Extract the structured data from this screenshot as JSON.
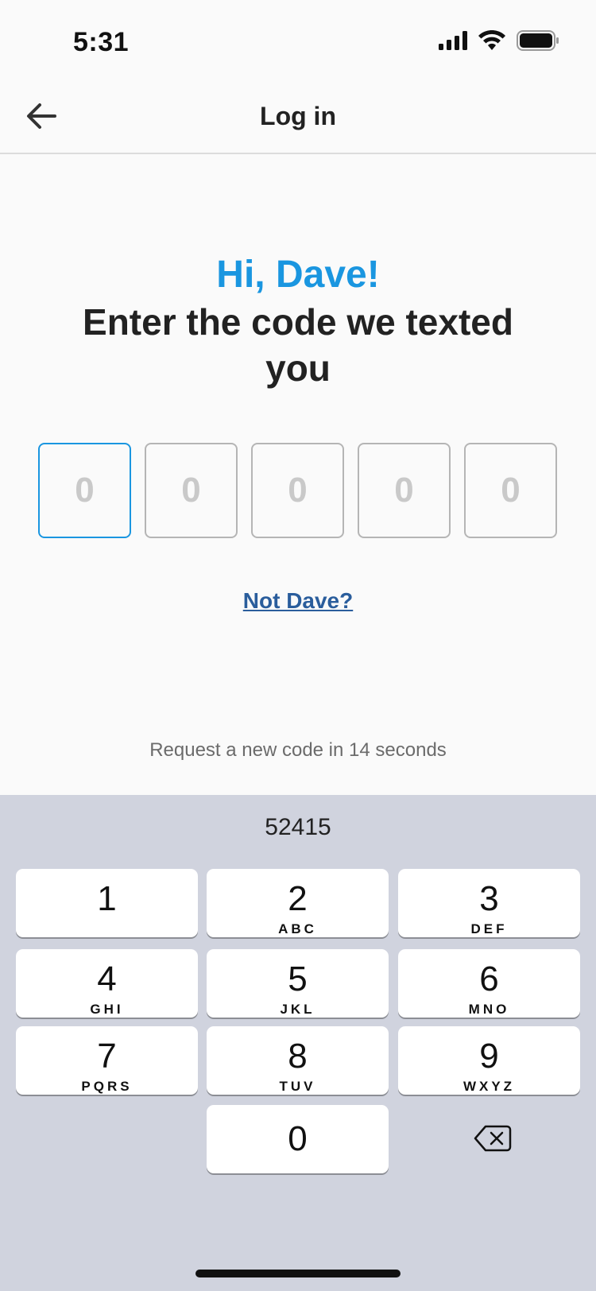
{
  "status_bar": {
    "time": "5:31"
  },
  "nav": {
    "title": "Log in"
  },
  "greeting": "Hi, Dave!",
  "heading": "Enter the code we texted you",
  "code_placeholders": [
    "0",
    "0",
    "0",
    "0",
    "0"
  ],
  "not_user_link": "Not Dave?",
  "resend_text": "Request a new code in 14 seconds",
  "keyboard": {
    "suggestion": "52415",
    "keys": [
      {
        "num": "1",
        "letters": ""
      },
      {
        "num": "2",
        "letters": "ABC"
      },
      {
        "num": "3",
        "letters": "DEF"
      },
      {
        "num": "4",
        "letters": "GHI"
      },
      {
        "num": "5",
        "letters": "JKL"
      },
      {
        "num": "6",
        "letters": "MNO"
      },
      {
        "num": "7",
        "letters": "PQRS"
      },
      {
        "num": "8",
        "letters": "TUV"
      },
      {
        "num": "9",
        "letters": "WXYZ"
      },
      {
        "num": "0",
        "letters": ""
      }
    ]
  },
  "colors": {
    "accent": "#1a96e0",
    "link": "#2a5d9c",
    "keyboard_bg": "#d0d3de"
  }
}
